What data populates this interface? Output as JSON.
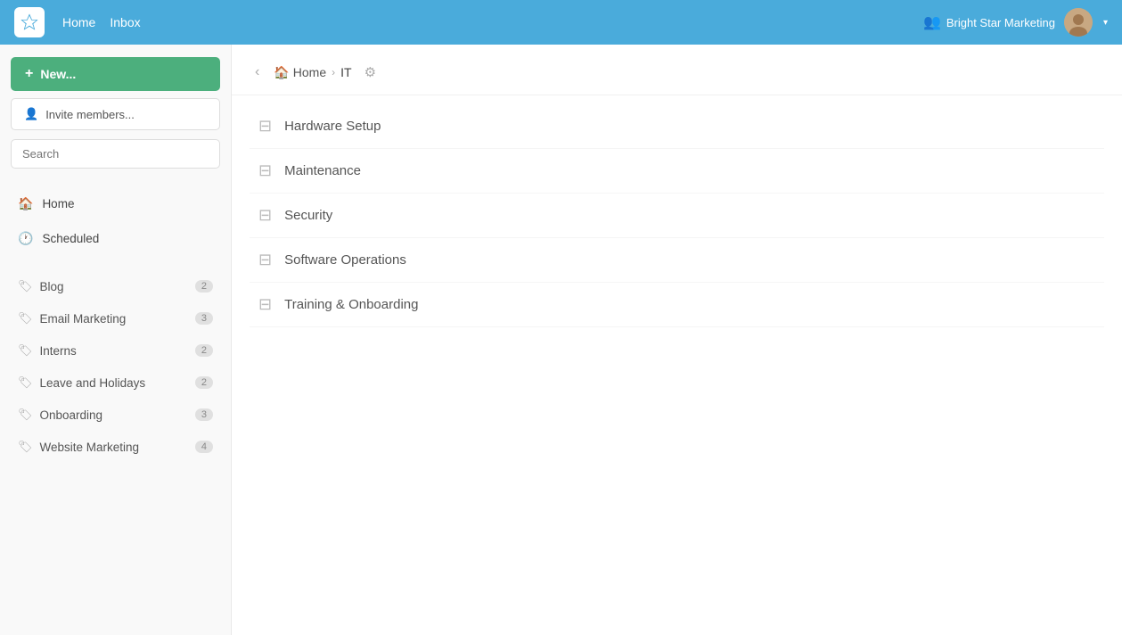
{
  "topnav": {
    "home_label": "Home",
    "inbox_label": "Inbox",
    "org_name": "Bright Star Marketing",
    "logo_alt": "Bright Star Logo"
  },
  "sidebar": {
    "new_button_label": "New...",
    "invite_button_label": "Invite members...",
    "search_placeholder": "Search",
    "nav_items": [
      {
        "id": "home",
        "label": "Home",
        "icon": "🏠"
      },
      {
        "id": "scheduled",
        "label": "Scheduled",
        "icon": "🕐"
      }
    ],
    "tags": [
      {
        "id": "blog",
        "label": "Blog",
        "count": "2"
      },
      {
        "id": "email-marketing",
        "label": "Email Marketing",
        "count": "3"
      },
      {
        "id": "interns",
        "label": "Interns",
        "count": "2"
      },
      {
        "id": "leave-and-holidays",
        "label": "Leave and Holidays",
        "count": "2"
      },
      {
        "id": "onboarding",
        "label": "Onboarding",
        "count": "3"
      },
      {
        "id": "website-marketing",
        "label": "Website Marketing",
        "count": "4"
      }
    ]
  },
  "main": {
    "breadcrumb": {
      "home": "Home",
      "current": "IT"
    },
    "folders": [
      {
        "id": "hardware-setup",
        "label": "Hardware Setup"
      },
      {
        "id": "maintenance",
        "label": "Maintenance"
      },
      {
        "id": "security",
        "label": "Security"
      },
      {
        "id": "software-operations",
        "label": "Software Operations"
      },
      {
        "id": "training-onboarding",
        "label": "Training & Onboarding"
      }
    ]
  }
}
